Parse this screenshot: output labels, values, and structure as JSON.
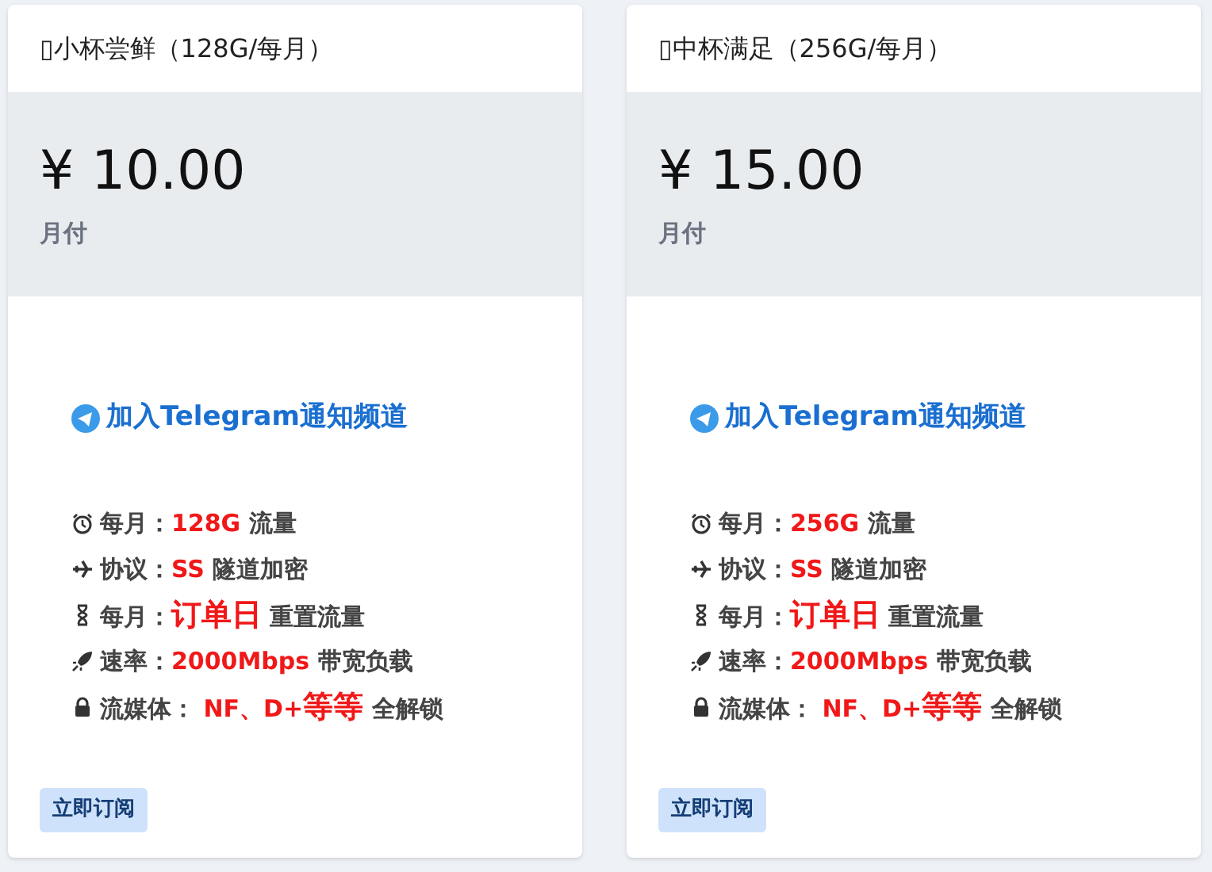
{
  "plans": [
    {
      "title": "▯小杯尝鲜（128G/每月）",
      "price": "¥ 10.00",
      "period": "月付",
      "link": "加入Telegram通知频道",
      "features": [
        {
          "kind": "alarm",
          "parts": [
            {
              "kind": "plain",
              "text": "每月："
            },
            {
              "kind": "accent",
              "text": "128G"
            },
            {
              "kind": "plain",
              "text": " 流量"
            }
          ]
        },
        {
          "kind": "plane",
          "parts": [
            {
              "kind": "plain",
              "text": "协议："
            },
            {
              "kind": "accent",
              "text": "SS"
            },
            {
              "kind": "plain",
              "text": " 隧道加密"
            }
          ]
        },
        {
          "kind": "hourglass",
          "parts": [
            {
              "kind": "plain",
              "text": "每月："
            },
            {
              "kind": "accent-large",
              "text": "订单日"
            },
            {
              "kind": "plain",
              "text": " 重置流量"
            }
          ]
        },
        {
          "kind": "rocket",
          "parts": [
            {
              "kind": "plain",
              "text": "速率："
            },
            {
              "kind": "accent",
              "text": "2000Mbps"
            },
            {
              "kind": "plain",
              "text": " 带宽负载"
            }
          ]
        },
        {
          "kind": "lock",
          "parts": [
            {
              "kind": "plain",
              "text": "流媒体："
            },
            {
              "kind": "accent",
              "text": " NF、D+"
            },
            {
              "kind": "accent-large",
              "text": "等等"
            },
            {
              "kind": "plain",
              "text": " 全解锁"
            }
          ]
        }
      ],
      "button": "立即订阅"
    },
    {
      "title": "▯中杯满足（256G/每月）",
      "price": "¥ 15.00",
      "period": "月付",
      "link": "加入Telegram通知频道",
      "features": [
        {
          "kind": "alarm",
          "parts": [
            {
              "kind": "plain",
              "text": "每月："
            },
            {
              "kind": "accent",
              "text": "256G"
            },
            {
              "kind": "plain",
              "text": " 流量"
            }
          ]
        },
        {
          "kind": "plane",
          "parts": [
            {
              "kind": "plain",
              "text": "协议："
            },
            {
              "kind": "accent",
              "text": "SS"
            },
            {
              "kind": "plain",
              "text": " 隧道加密"
            }
          ]
        },
        {
          "kind": "hourglass",
          "parts": [
            {
              "kind": "plain",
              "text": "每月："
            },
            {
              "kind": "accent-large",
              "text": "订单日"
            },
            {
              "kind": "plain",
              "text": " 重置流量"
            }
          ]
        },
        {
          "kind": "rocket",
          "parts": [
            {
              "kind": "plain",
              "text": "速率："
            },
            {
              "kind": "accent",
              "text": "2000Mbps"
            },
            {
              "kind": "plain",
              "text": " 带宽负载"
            }
          ]
        },
        {
          "kind": "lock",
          "parts": [
            {
              "kind": "plain",
              "text": "流媒体："
            },
            {
              "kind": "accent",
              "text": " NF、D+"
            },
            {
              "kind": "accent-large",
              "text": "等等"
            },
            {
              "kind": "plain",
              "text": " 全解锁"
            }
          ]
        }
      ],
      "button": "立即订阅"
    }
  ]
}
